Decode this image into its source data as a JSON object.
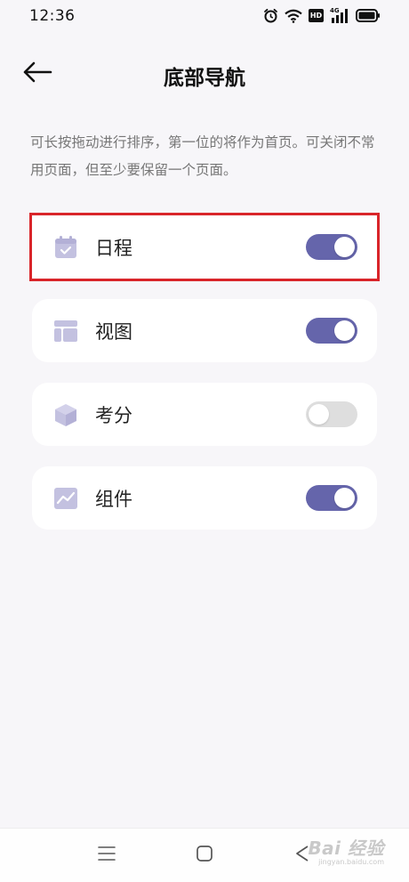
{
  "status_bar": {
    "time": "12:36",
    "hd_label": "HD",
    "network_label": "4G",
    "icons": [
      "alarm-icon",
      "wifi-icon",
      "hd-icon",
      "signal-icon",
      "battery-icon"
    ]
  },
  "header": {
    "title": "底部导航",
    "back_icon": "arrow-left-icon"
  },
  "description": "可长按拖动进行排序，第一位的将作为首页。可关闭不常用页面，但至少要保留一个页面。",
  "nav_items": [
    {
      "label": "日程",
      "icon": "calendar-icon",
      "enabled": true,
      "highlighted": true
    },
    {
      "label": "视图",
      "icon": "layout-icon",
      "enabled": true,
      "highlighted": false
    },
    {
      "label": "考分",
      "icon": "cube-icon",
      "enabled": false,
      "highlighted": false
    },
    {
      "label": "组件",
      "icon": "chart-widget-icon",
      "enabled": true,
      "highlighted": false
    }
  ],
  "system_nav": {
    "buttons": [
      "menu-icon",
      "home-icon",
      "back-triangle-icon"
    ]
  },
  "watermark": {
    "main": "Bai 经验",
    "sub": "jingyan.baidu.com"
  },
  "colors": {
    "accent": "#6565ab",
    "highlight_border": "#d9252a",
    "icon_tint": "#c3c1e0",
    "background": "#f7f6f9"
  }
}
